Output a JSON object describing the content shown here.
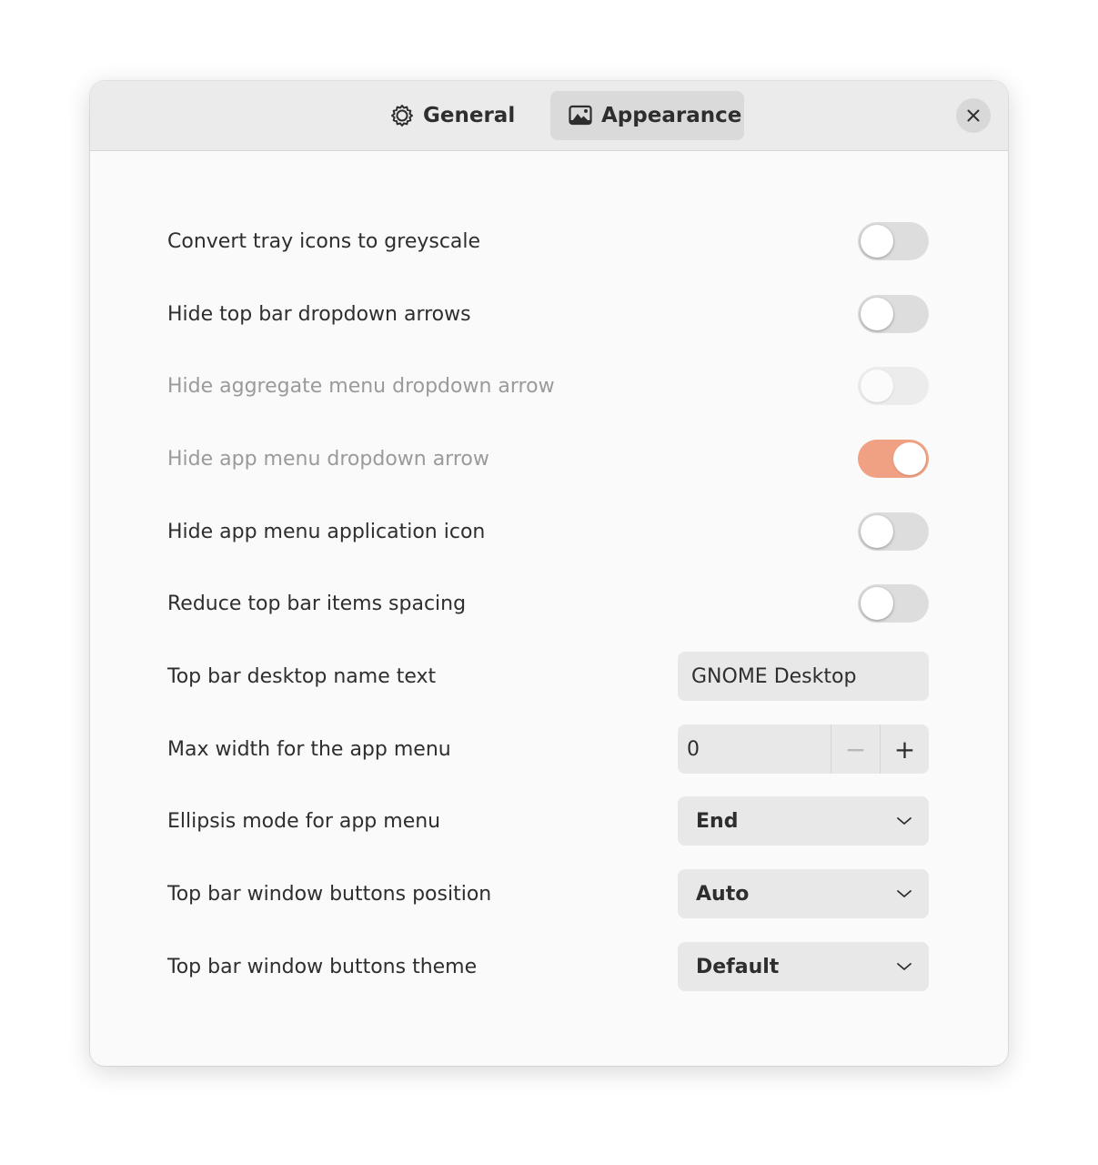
{
  "header": {
    "tabs": [
      {
        "label": "General",
        "icon": "gear-icon",
        "selected": false
      },
      {
        "label": "Appearance",
        "icon": "image-icon",
        "selected": true
      }
    ],
    "close_icon": "close-icon"
  },
  "settings": {
    "convert_tray_icons": {
      "label": "Convert tray icons to greyscale",
      "value": false,
      "sensitive": true
    },
    "hide_dropdown_arrows": {
      "label": "Hide top bar dropdown arrows",
      "value": false,
      "sensitive": true
    },
    "hide_aggregate_arrow": {
      "label": "Hide aggregate menu dropdown arrow",
      "value": false,
      "sensitive": false
    },
    "hide_app_menu_arrow": {
      "label": "Hide app menu dropdown arrow",
      "value": true,
      "sensitive": false
    },
    "hide_app_menu_icon": {
      "label": "Hide app menu application icon",
      "value": false,
      "sensitive": true
    },
    "reduce_spacing": {
      "label": "Reduce top bar items spacing",
      "value": false,
      "sensitive": true
    },
    "desktop_name": {
      "label": "Top bar desktop name text",
      "value": "GNOME Desktop"
    },
    "max_width": {
      "label": "Max width for the app menu",
      "value": "0",
      "decrement": "−",
      "increment": "+"
    },
    "ellipsis_mode": {
      "label": "Ellipsis mode for app menu",
      "value": "End"
    },
    "buttons_position": {
      "label": "Top bar window buttons position",
      "value": "Auto"
    },
    "buttons_theme": {
      "label": "Top bar window buttons theme",
      "value": "Default"
    }
  },
  "colors": {
    "accent": "#f0a184",
    "headerbar": "#ebebeb",
    "window_bg": "#fafafa"
  }
}
